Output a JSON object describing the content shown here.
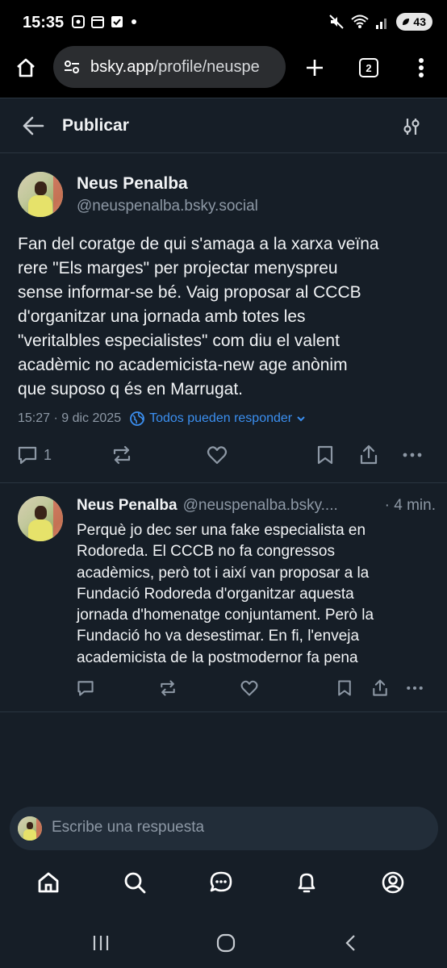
{
  "status_bar": {
    "time": "15:35",
    "battery": "43"
  },
  "browser": {
    "url_host": "bsky.app",
    "url_path": "/profile/neuspe",
    "tab_count": "2"
  },
  "header": {
    "title": "Publicar"
  },
  "main_post": {
    "author_name": "Neus Penalba",
    "author_handle": "@neuspenalba.bsky.social",
    "text_lines": [
      "Fan del coratge de qui s'amaga a la xarxa veïna",
      "rere \"Els marges\" per projectar menyspreu",
      "sense informar-se bé. Vaig proposar al CCCB",
      "d'organitzar una jornada amb totes les",
      "\"veritalbles especialistes\" com diu el valent",
      "acadèmic no academicista-new age anònim",
      "que suposo q és en Marrugat."
    ],
    "timestamp": "15:27 · 9 dic 2025",
    "reply_setting": "Todos pueden responder",
    "reply_count": "1"
  },
  "reply": {
    "author_name": "Neus Penalba",
    "author_handle": "@neuspenalba.bsky....",
    "time_ago": "· 4 min.",
    "text_lines": [
      "Perquè jo dec ser una fake especialista en",
      "Rodoreda. El CCCB no fa congressos",
      "acadèmics, però tot i així van proposar a la",
      "Fundació Rodoreda d'organitzar aquesta",
      "jornada d'homenatge conjuntament. Però la",
      "Fundació ho va desestimar. En fi, l'enveja",
      "academicista de la postmodernor fa pena"
    ]
  },
  "composer": {
    "placeholder": "Escribe una respuesta"
  },
  "colors": {
    "background": "#161e27",
    "accent": "#3b8ff0",
    "muted": "#8d98a5"
  },
  "icons": [
    "home-icon",
    "search-icon",
    "chat-icon",
    "bell-icon",
    "profile-icon",
    "back-arrow-icon",
    "settings-sliders-icon",
    "reply-icon",
    "repost-icon",
    "like-icon",
    "bookmark-icon",
    "share-icon",
    "more-icon"
  ]
}
